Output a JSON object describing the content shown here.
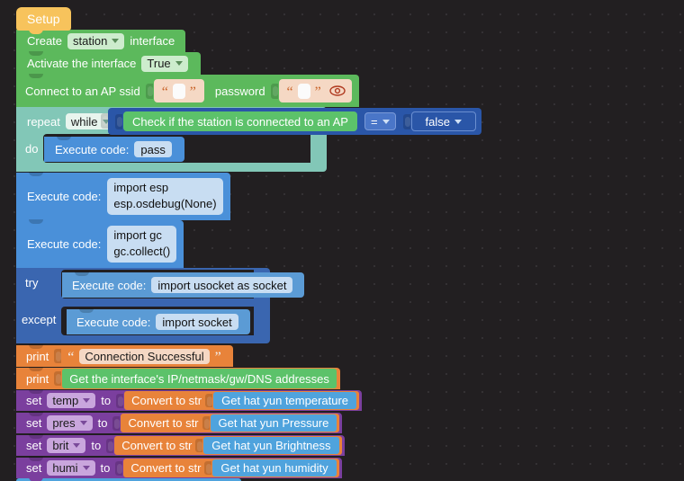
{
  "workspace": {
    "title": "Blockly visual programming workspace",
    "background_color": "#221f21",
    "grid_dot_color": "#3a373a"
  },
  "colors": {
    "hat": "#f7c35c",
    "green": "#5cb95c",
    "teal": "#82c7b7",
    "blue": "#4a90d9",
    "dark_blue": "#3a66b0",
    "light_blue": "#5b9bd5",
    "orange": "#e8833a",
    "purple": "#7b3f9e",
    "sky_blue": "#4fa3dd",
    "logic_blue": "#2a56a8"
  },
  "hat_block": {
    "label": "Setup"
  },
  "blocks": {
    "create_interface": {
      "prefix": "Create",
      "dropdown_value": "station",
      "suffix": "interface"
    },
    "activate_interface": {
      "prefix": "Activate the interface",
      "dropdown_value": "True"
    },
    "connect_ap": {
      "prefix": "Connect to an AP ssid",
      "ssid_value": "",
      "middle": "password",
      "password_value": "",
      "eye_icon": "eye-icon",
      "open_quote": "“",
      "close_quote": "”"
    },
    "repeat_loop": {
      "prefix": "repeat",
      "mode": "while",
      "do_label": "do",
      "condition_text": "Check if the station is connected to an AP",
      "operator": "=",
      "operand": "false",
      "body_code": "pass",
      "body_prefix": "Execute code:"
    },
    "execute_esp": {
      "prefix": "Execute code:",
      "lines": [
        "import esp",
        "esp.osdebug(None)"
      ]
    },
    "execute_gc": {
      "prefix": "Execute code:",
      "lines": [
        "import gc",
        "gc.collect()"
      ]
    },
    "try_except": {
      "try_label": "try",
      "except_label": "except",
      "try_prefix": "Execute code:",
      "try_code": "import usocket as socket",
      "except_prefix": "Execute code:",
      "except_code": "import socket"
    },
    "print_connection": {
      "label": "print",
      "open_quote": "“",
      "close_quote": "”",
      "text_value": "Connection Successful"
    },
    "print_addresses": {
      "label": "print",
      "value_text": "Get the interface's IP/netmask/gw/DNS addresses"
    }
  },
  "set_rows": [
    {
      "set_label": "set",
      "variable": "temp",
      "to_label": "to",
      "convert_label": "Convert to str",
      "sensor_label": "Get hat yun temperature"
    },
    {
      "set_label": "set",
      "variable": "pres",
      "to_label": "to",
      "convert_label": "Convert to str",
      "sensor_label": "Get hat yun Pressure"
    },
    {
      "set_label": "set",
      "variable": "brit",
      "to_label": "to",
      "convert_label": "Convert to str",
      "sensor_label": "Get hat yun Brightness"
    },
    {
      "set_label": "set",
      "variable": "humi",
      "to_label": "to",
      "convert_label": "Convert to str",
      "sensor_label": "Get hat yun humidity"
    }
  ]
}
